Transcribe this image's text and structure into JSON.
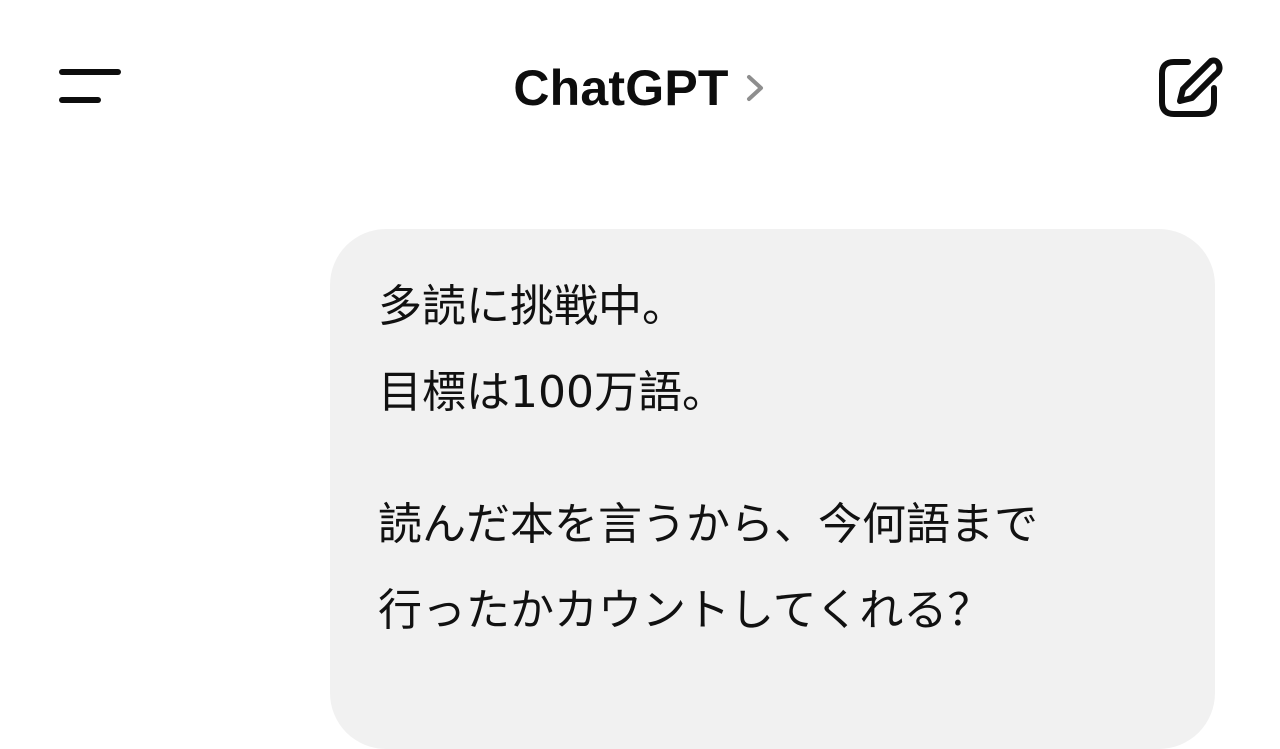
{
  "header": {
    "title": "ChatGPT",
    "chevron_icon": "chevron-right-icon",
    "menu_icon": "menu-icon",
    "new_chat_icon": "new-chat-icon"
  },
  "message": {
    "paragraph1": {
      "line1": "多読に挑戦中。",
      "line2": "目標は100万語。"
    },
    "paragraph2": {
      "line1": "読んだ本を言うから、今何語まで",
      "line2": "行ったかカウントしてくれる？"
    }
  },
  "colors": {
    "bubble_background": "#f1f1f1",
    "text": "#0d0d0d",
    "chevron": "#8e8e8e"
  }
}
